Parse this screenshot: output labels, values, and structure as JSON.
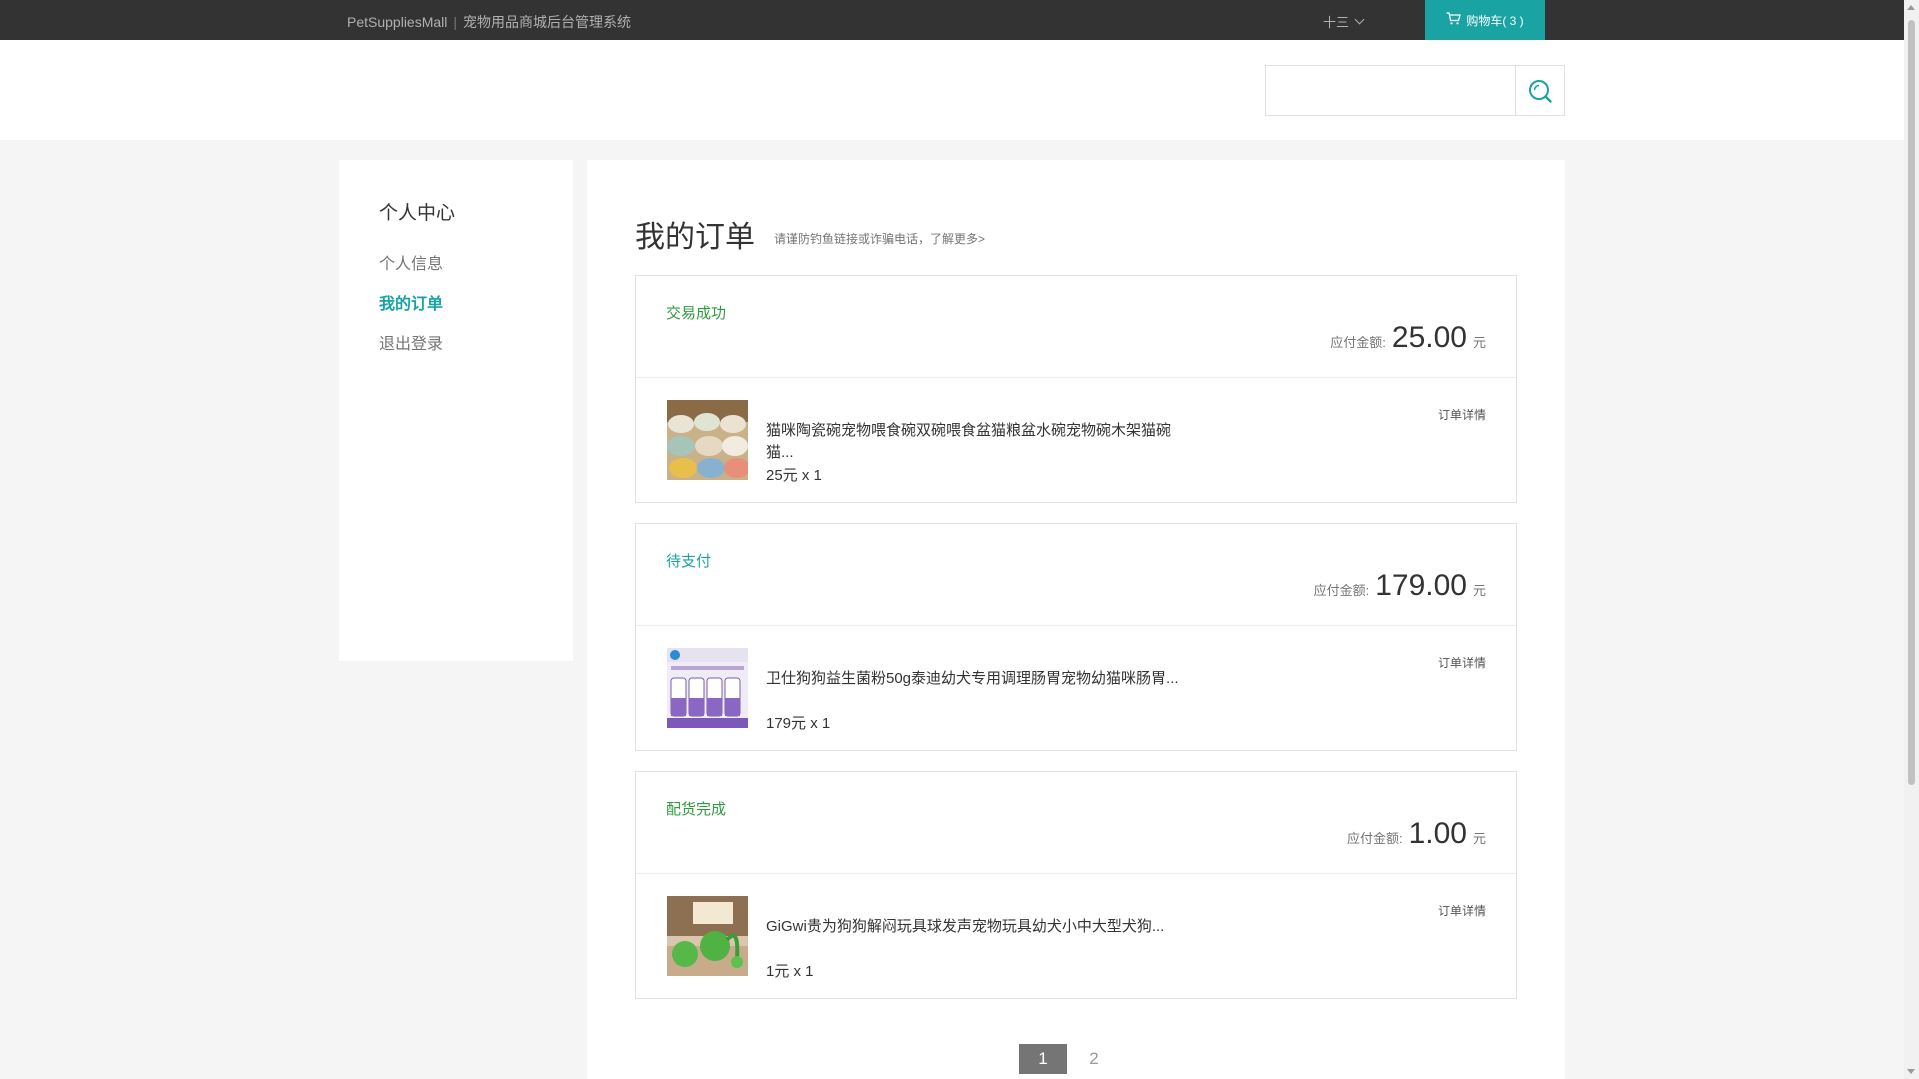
{
  "topbar": {
    "brand": "PetSuppliesMall",
    "brand_separator": "|",
    "system_name": "宠物用品商城后台管理系统",
    "username": "十三",
    "cart_label": "购物车( 3 )"
  },
  "search": {
    "placeholder": "",
    "value": ""
  },
  "sidebar": {
    "title": "个人中心",
    "items": [
      {
        "label": "个人信息",
        "active": false
      },
      {
        "label": "我的订单",
        "active": true
      },
      {
        "label": "退出登录",
        "active": false
      }
    ]
  },
  "main": {
    "title": "我的订单",
    "tip": "请谨防钓鱼链接或诈骗电话，了解更多>",
    "amount_label": "应付金额:",
    "currency_unit": "元",
    "detail_label": "订单详情",
    "orders": [
      {
        "status": "交易成功",
        "status_color": "#2e9b3e",
        "amount": "25.00",
        "product_name": "猫咪陶瓷碗宠物喂食碗双碗喂食盆猫粮盆水碗宠物碗木架猫碗猫...",
        "product_price": "25元 x 1",
        "thumb": "ceramic-bowls-photo"
      },
      {
        "status": "待支付",
        "status_color": "#1aa3a3",
        "amount": "179.00",
        "product_name": "卫仕狗狗益生菌粉50g泰迪幼犬专用调理肠胃宠物幼猫咪肠胃...",
        "product_price": "179元 x 1",
        "thumb": "probiotic-bottles-photo"
      },
      {
        "status": "配货完成",
        "status_color": "#2e9b3e",
        "amount": "1.00",
        "product_name": "GiGwi贵为狗狗解闷玩具球发声宠物玩具幼犬小中大型犬狗...",
        "product_price": "1元 x 1",
        "thumb": "green-toy-ball-photo"
      }
    ]
  },
  "pagination": {
    "current": "1",
    "next": "2"
  },
  "colors": {
    "accent": "#1aa3a3",
    "topbar": "#333333",
    "success": "#2e9b3e"
  }
}
